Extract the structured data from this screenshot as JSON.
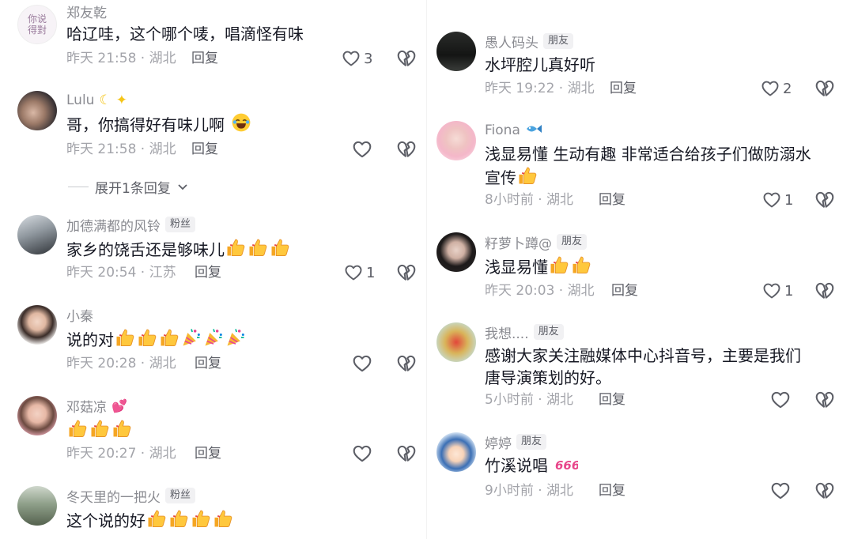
{
  "left": [
    {
      "username": "郑友乾",
      "badge": "",
      "text": "哈辽哇，这个哪个唛，唱滴怪有味",
      "time": "昨天 21:58 · 湖北",
      "reply": "回复",
      "likes": "3"
    },
    {
      "username": "Lulu",
      "badge": "",
      "text": "哥，你搞得好有味儿啊",
      "time": "昨天 21:58 · 湖北",
      "reply": "回复",
      "likes": ""
    },
    {
      "username": "加德满都的风铃",
      "badge": "粉丝",
      "text": "家乡的饶舌还是够味儿",
      "time": "昨天 20:54 · 江苏",
      "reply": "回复",
      "likes": "1"
    },
    {
      "username": "小秦",
      "badge": "",
      "text": "说的对",
      "time": "昨天 20:28 · 湖北",
      "reply": "回复",
      "likes": ""
    },
    {
      "username": "邓菇凉",
      "badge": "",
      "text": "",
      "time": "昨天 20:27 · 湖北",
      "reply": "回复",
      "likes": ""
    },
    {
      "username": "冬天里的一把火",
      "badge": "粉丝",
      "text": "这个说的好",
      "time": "",
      "reply": "",
      "likes": ""
    }
  ],
  "expand_label": "展开1条回复",
  "right": [
    {
      "username": "愚人码头",
      "badge": "朋友",
      "text": "水坪腔儿真好听",
      "time": "昨天 19:22 · 湖北",
      "reply": "回复",
      "likes": "2"
    },
    {
      "username": "Fiona",
      "badge": "",
      "text": "浅显易懂  生动有趣 非常适合给孩子们做防溺水",
      "text2": "宣传",
      "time": "8小时前 · 湖北",
      "reply": "回复",
      "likes": "1"
    },
    {
      "username": "籽萝卜蹲@",
      "badge": "朋友",
      "text": "浅显易懂",
      "time": "昨天 20:03 · 湖北",
      "reply": "回复",
      "likes": "1"
    },
    {
      "username": "我想....",
      "badge": "朋友",
      "text": "感谢大家关注融媒体中心抖音号，主要是我们",
      "text2": "唐导演策划的好。",
      "time": "5小时前 · 湖北",
      "reply": "回复",
      "likes": ""
    },
    {
      "username": "婷婷",
      "badge": "朋友",
      "text": "竹溪说唱",
      "time": "9小时前 · 湖北",
      "reply": "回复",
      "likes": ""
    }
  ],
  "avatar_text": "你说得對",
  "colors": {
    "username": "#8a8b91",
    "meta": "#a3a4aa",
    "text": "#161823",
    "icon": "#5c5e66"
  }
}
